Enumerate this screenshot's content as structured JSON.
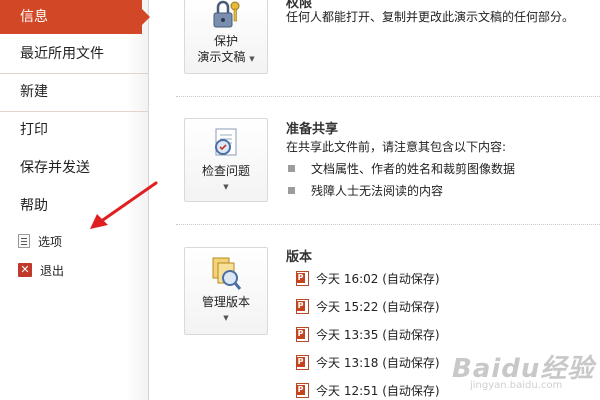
{
  "sidebar": {
    "items": [
      {
        "label": "信息",
        "active": true
      },
      {
        "label": "最近所用文件"
      },
      {
        "label": "新建"
      },
      {
        "label": "打印"
      },
      {
        "label": "保存并发送"
      },
      {
        "label": "帮助"
      }
    ],
    "options_label": "选项",
    "exit_label": "退出",
    "options_icon": "options-icon",
    "exit_icon": "exit-icon",
    "accent_color": "#d24726"
  },
  "protect": {
    "partial_title": "权限",
    "button_line1": "保护",
    "button_line2": "演示文稿",
    "description": "任何人都能打开、复制并更改此演示文稿的任何部分。",
    "icon": "lock-key-icon"
  },
  "prepare": {
    "title": "准备共享",
    "button_label": "检查问题",
    "description": "在共享此文件前，请注意其包含以下内容:",
    "bullets": [
      "文档属性、作者的姓名和裁剪图像数据",
      "残障人士无法阅读的内容"
    ],
    "icon": "inspect-document-icon"
  },
  "versions": {
    "title": "版本",
    "button_label": "管理版本",
    "icon": "manage-versions-icon",
    "items": [
      "今天 16:02 (自动保存)",
      "今天 15:22 (自动保存)",
      "今天 13:35 (自动保存)",
      "今天 13:18 (自动保存)",
      "今天 12:51 (自动保存)"
    ]
  },
  "watermark": {
    "text": "Baidu经验",
    "url": "jingyan.baidu.com"
  }
}
